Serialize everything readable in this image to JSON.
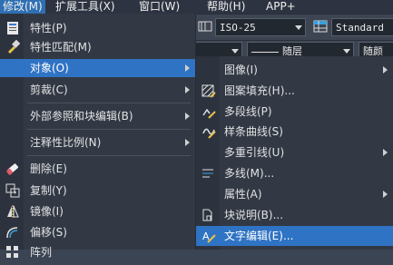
{
  "menubar": {
    "items": [
      {
        "label": "修改(M)",
        "active": true
      },
      {
        "label": "扩展工具(X)",
        "active": false
      },
      {
        "label": "窗口(W)",
        "active": false
      },
      {
        "label": "帮助(H)",
        "active": false
      },
      {
        "label": "APP+",
        "active": false
      }
    ]
  },
  "toolbar": {
    "dimstyle_value": "ISO-25",
    "tablestyle_value": "Standard",
    "linetype_value": "随层",
    "lineweight_value": "随颜"
  },
  "menu": {
    "items": [
      {
        "label": "特性(P)",
        "icon": "properties-icon"
      },
      {
        "label": "特性匹配(M)",
        "icon": "match-properties-icon"
      },
      {
        "label": "对象(O)",
        "icon": "",
        "highlighted": true,
        "submenu": true
      },
      {
        "label": "剪裁(C)",
        "icon": "",
        "submenu": true
      },
      {
        "label": "外部参照和块编辑(B)",
        "icon": "",
        "submenu": true
      },
      {
        "label": "注释性比例(N)",
        "icon": "",
        "submenu": true
      },
      {
        "label": "删除(E)",
        "icon": "erase-icon"
      },
      {
        "label": "复制(Y)",
        "icon": "copy-icon"
      },
      {
        "label": "镜像(I)",
        "icon": "mirror-icon"
      },
      {
        "label": "偏移(S)",
        "icon": "offset-icon"
      },
      {
        "label": "阵列",
        "icon": "array-icon"
      }
    ]
  },
  "submenu": {
    "items": [
      {
        "label": "图像(I)",
        "icon": "",
        "submenu": true
      },
      {
        "label": "图案填充(H)...",
        "icon": "hatch-edit-icon"
      },
      {
        "label": "多段线(P)",
        "icon": "polyline-edit-icon"
      },
      {
        "label": "样条曲线(S)",
        "icon": "spline-edit-icon"
      },
      {
        "label": "多重引线(U)",
        "icon": "",
        "submenu": true
      },
      {
        "label": "多线(M)...",
        "icon": "multiline-edit-icon"
      },
      {
        "label": "属性(A)",
        "icon": "",
        "submenu": true
      },
      {
        "label": "块说明(B)...",
        "icon": "block-description-icon"
      },
      {
        "label": "文字编辑(E)...",
        "icon": "text-edit-icon",
        "highlighted": true
      }
    ]
  },
  "colors": {
    "highlight": "#2f73c4",
    "menu_bg": "#323945",
    "menubar_bg": "#2d3340",
    "text": "#e2e2e2"
  }
}
